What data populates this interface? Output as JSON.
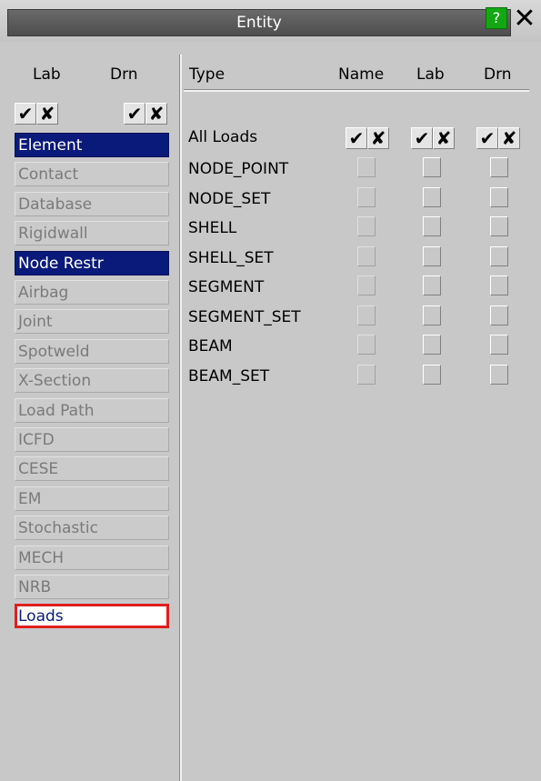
{
  "window": {
    "title": "Entity",
    "help": "?",
    "close": "✕"
  },
  "left_headers": {
    "lab": "Lab",
    "drn": "Drn"
  },
  "right_headers": {
    "type": "Type",
    "name": "Name",
    "lab": "Lab",
    "drn": "Drn"
  },
  "check_glyph": "✔",
  "cross_glyph": "✘",
  "categories": [
    {
      "label": "Element",
      "state": "selected"
    },
    {
      "label": "Contact",
      "state": "normal"
    },
    {
      "label": "Database",
      "state": "normal"
    },
    {
      "label": "Rigidwall",
      "state": "normal"
    },
    {
      "label": "Node Restr",
      "state": "selected"
    },
    {
      "label": "Airbag",
      "state": "normal"
    },
    {
      "label": "Joint",
      "state": "normal"
    },
    {
      "label": "Spotweld",
      "state": "normal"
    },
    {
      "label": "X-Section",
      "state": "normal"
    },
    {
      "label": "Load Path",
      "state": "normal"
    },
    {
      "label": "ICFD",
      "state": "normal"
    },
    {
      "label": "CESE",
      "state": "normal"
    },
    {
      "label": "EM",
      "state": "normal"
    },
    {
      "label": "Stochastic",
      "state": "normal"
    },
    {
      "label": "MECH",
      "state": "normal"
    },
    {
      "label": "NRB",
      "state": "normal"
    },
    {
      "label": "Loads",
      "state": "highlighted"
    }
  ],
  "all_loads_label": "All Loads",
  "load_types": [
    "NODE_POINT",
    "NODE_SET",
    "SHELL",
    "SHELL_SET",
    "SEGMENT",
    "SEGMENT_SET",
    "BEAM",
    "BEAM_SET"
  ],
  "colors": {
    "selected_bg": "#0a1a7a",
    "highlight_border": "#e01e1e",
    "help_green": "#13a813"
  }
}
